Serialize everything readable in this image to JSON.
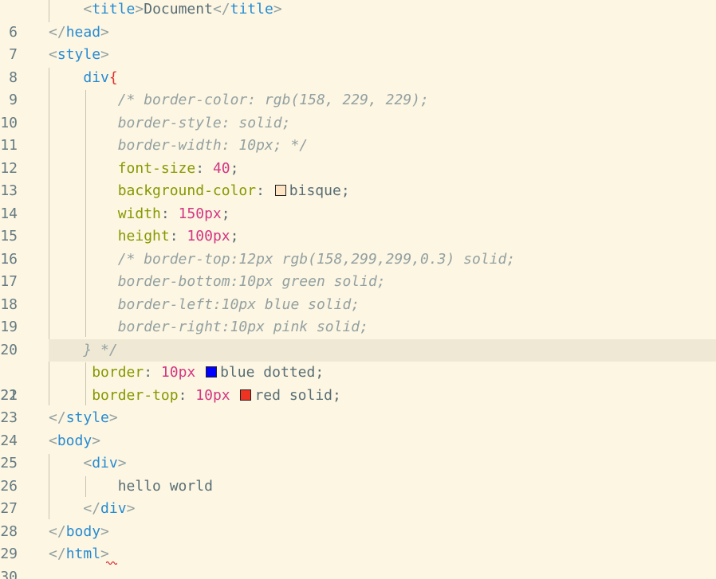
{
  "colors": {
    "background": "#fdf6e3",
    "current_line": "#eee8d5",
    "swatch_bisque": "#ffe4c4",
    "swatch_blue": "#0000ff",
    "swatch_red": "#ee3322"
  },
  "lines": [
    {
      "num": "6"
    },
    {
      "num": "7"
    },
    {
      "num": "8"
    },
    {
      "num": "9"
    },
    {
      "num": "10"
    },
    {
      "num": "11"
    },
    {
      "num": "12"
    },
    {
      "num": "13"
    },
    {
      "num": "14"
    },
    {
      "num": "15"
    },
    {
      "num": "16"
    },
    {
      "num": "17"
    },
    {
      "num": "18"
    },
    {
      "num": "19"
    },
    {
      "num": "20"
    },
    {
      "num": "21"
    },
    {
      "num": "22"
    },
    {
      "num": "23"
    },
    {
      "num": "24"
    },
    {
      "num": "25"
    },
    {
      "num": "26"
    },
    {
      "num": "27"
    },
    {
      "num": "28"
    },
    {
      "num": "29"
    },
    {
      "num": "30"
    }
  ],
  "code": {
    "l6": {
      "indent": "    ",
      "open": "<",
      "tag1": "title",
      "close1": ">",
      "text": "Document",
      "open2": "</",
      "tag2": "title",
      "close2": ">"
    },
    "l7": {
      "open": "</",
      "tag": "head",
      "close": ">"
    },
    "l8": {
      "open": "<",
      "tag": "style",
      "close": ">"
    },
    "l9": {
      "indent": "    ",
      "selector": "div",
      "brace": "{"
    },
    "l10": {
      "indent": "        ",
      "comment": "/* border-color: rgb(158, 229, 229);"
    },
    "l11": {
      "indent": "        ",
      "comment": "border-style: solid;"
    },
    "l12": {
      "indent": "        ",
      "comment": "border-width: 10px; */"
    },
    "l13": {
      "indent": "        ",
      "prop": "font-size",
      "colon": ": ",
      "num": "40",
      "semi": ";"
    },
    "l14": {
      "indent": "        ",
      "prop": "background-color",
      "colon": ": ",
      "value": "bisque",
      "semi": ";"
    },
    "l15": {
      "indent": "        ",
      "prop": "width",
      "colon": ": ",
      "num": "150",
      "unit": "px",
      "semi": ";"
    },
    "l16": {
      "indent": "        ",
      "prop": "height",
      "colon": ": ",
      "num": "100",
      "unit": "px",
      "semi": ";"
    },
    "l17": {
      "indent": "        ",
      "comment": "/* border-top:12px rgb(158,299,299,0.3) solid;"
    },
    "l18": {
      "indent": "        ",
      "comment": "border-bottom:10px green solid;"
    },
    "l19": {
      "indent": "        ",
      "comment": "border-left:10px blue solid;"
    },
    "l20": {
      "indent": "        ",
      "comment": "border-right:10px pink solid;"
    },
    "l21": {
      "indent": "    ",
      "comment": "} */"
    },
    "l22": {
      "indent": "     ",
      "prop": "border",
      "colon": ": ",
      "num": "10",
      "unit": "px",
      "value": "blue dotted",
      "semi": ";"
    },
    "l23": {
      "indent": "     ",
      "prop": "border-top",
      "colon": ": ",
      "num": "10",
      "unit": "px",
      "value": "red solid",
      "semi": ";"
    },
    "l24": {
      "open": "</",
      "tag": "style",
      "close": ">"
    },
    "l25": {
      "open": "<",
      "tag": "body",
      "close": ">"
    },
    "l26": {
      "indent": "    ",
      "open": "<",
      "tag": "div",
      "close": ">"
    },
    "l27": {
      "indent": "        ",
      "text": "hello world"
    },
    "l28": {
      "indent": "    ",
      "open": "</",
      "tag": "div",
      "close": ">"
    },
    "l29": {
      "open": "</",
      "tag": "body",
      "close": ">"
    },
    "l30": {
      "open": "</",
      "tag": "html",
      "close": ">"
    }
  }
}
